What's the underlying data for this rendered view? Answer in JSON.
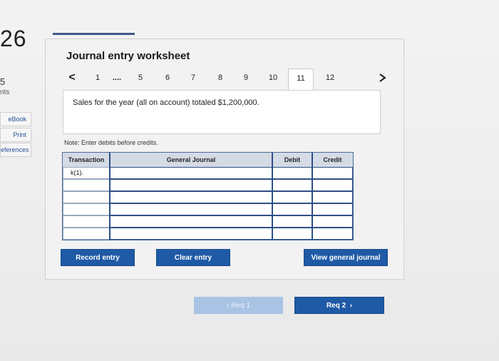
{
  "question": {
    "number": "26",
    "points_value": "5",
    "points_label": "nts"
  },
  "side_links": [
    {
      "label": "eBook"
    },
    {
      "label": "Print"
    },
    {
      "label": "eferences"
    }
  ],
  "worksheet": {
    "title": "Journal entry worksheet",
    "prev_icon": "<",
    "tabs": [
      "1",
      "....",
      "5",
      "6",
      "7",
      "8",
      "9",
      "10",
      "11",
      "12"
    ],
    "active_tab": "11",
    "next_icon": "chevron-right-icon",
    "description": "Sales for the year (all on account) totaled $1,200,000.",
    "note": "Note: Enter debits before credits."
  },
  "table": {
    "headers": {
      "transaction": "Transaction",
      "journal": "General Journal",
      "debit": "Debit",
      "credit": "Credit"
    },
    "rows": [
      {
        "transaction": "k(1).",
        "account": "",
        "debit": "",
        "credit": ""
      },
      {
        "transaction": "",
        "account": "",
        "debit": "",
        "credit": ""
      },
      {
        "transaction": "",
        "account": "",
        "debit": "",
        "credit": ""
      },
      {
        "transaction": "",
        "account": "",
        "debit": "",
        "credit": ""
      },
      {
        "transaction": "",
        "account": "",
        "debit": "",
        "credit": ""
      },
      {
        "transaction": "",
        "account": "",
        "debit": "",
        "credit": ""
      }
    ]
  },
  "buttons": {
    "record": "Record entry",
    "clear": "Clear entry",
    "view": "View general journal",
    "prev_req": "Req 1",
    "next_req": "Req 2"
  },
  "colors": {
    "accent": "#1f5aa6",
    "disabled": "#a9c3e4"
  }
}
